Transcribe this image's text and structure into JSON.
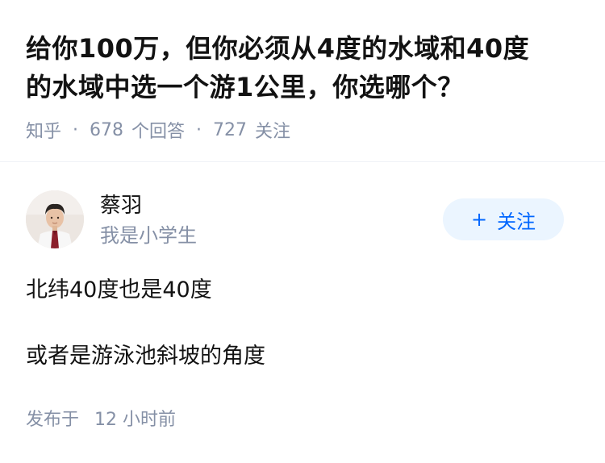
{
  "question": {
    "title_line1": "给你100万，但你必须从4度的水域和40度",
    "title_line2": "的水域中选一个游1公里，你选哪个？",
    "source": "知乎",
    "separator": "·",
    "answers_count": "678",
    "answers_label": "个回答",
    "followers_count": "727",
    "followers_label": "关注"
  },
  "author": {
    "name": "蔡羽",
    "bio": "我是小学生",
    "follow_plus": "+",
    "follow_label": "关注"
  },
  "answer": {
    "paragraphs": [
      "北纬40度也是40度",
      "或者是游泳池斜坡的角度"
    ]
  },
  "footer": {
    "published_label": "发布于",
    "published_time": "12 小时前"
  },
  "colors": {
    "accent": "#0066ff",
    "follow_bg": "#ebf5ff",
    "muted_text": "#8590a6",
    "text": "#121212"
  }
}
